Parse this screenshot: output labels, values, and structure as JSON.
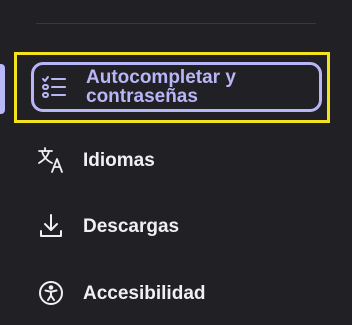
{
  "sidebar": {
    "items": [
      {
        "label": "Autocompletar y contraseñas",
        "icon": "list-checklist-icon",
        "active": true
      },
      {
        "label": "Idiomas",
        "icon": "translate-icon",
        "active": false
      },
      {
        "label": "Descargas",
        "icon": "download-icon",
        "active": false
      },
      {
        "label": "Accesibilidad",
        "icon": "accessibility-icon",
        "active": false
      }
    ]
  },
  "colors": {
    "background": "#212024",
    "active_accent": "#b8b6f6",
    "highlight_outline": "#f3e21e",
    "text": "#f0eff3"
  }
}
